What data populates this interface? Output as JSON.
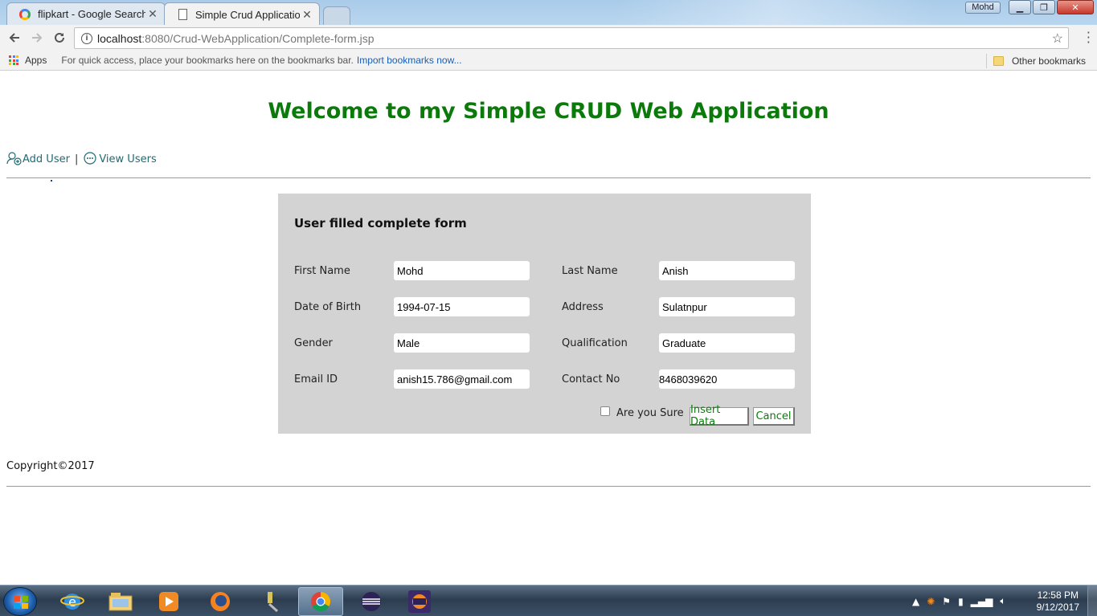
{
  "browser": {
    "tabs": [
      {
        "label": "flipkart - Google Search",
        "icon": "google-icon"
      },
      {
        "label": "Simple Crud Application",
        "icon": "document-icon"
      }
    ],
    "profile_name": "Mohd",
    "url_host": "localhost",
    "url_path": ":8080/Crud-WebApplication/Complete-form.jsp",
    "bookmarks": {
      "apps_label": "Apps",
      "hint": "For quick access, place your bookmarks here on the bookmarks bar.",
      "import_link": "Import bookmarks now...",
      "other": "Other bookmarks"
    }
  },
  "page": {
    "title": "Welcome to my Simple CRUD Web Application",
    "nav": {
      "add_user": "Add User",
      "separator": "|",
      "view_users": "View Users"
    },
    "form": {
      "title": "User filled complete form",
      "fields": {
        "first_name": {
          "label": "First Name",
          "value": "Mohd"
        },
        "last_name": {
          "label": "Last Name",
          "value": "Anish"
        },
        "dob": {
          "label": "Date of Birth",
          "value": "1994-07-15"
        },
        "address": {
          "label": "Address",
          "value": "Sulatnpur"
        },
        "gender": {
          "label": "Gender",
          "value": "Male"
        },
        "qualification": {
          "label": "Qualification",
          "value": "Graduate"
        },
        "email": {
          "label": "Email ID",
          "value": "anish15.786@gmail.com"
        },
        "contact": {
          "label": "Contact No",
          "value": "8468039620"
        }
      },
      "confirm_label": "Are you Sure",
      "insert_button": "Insert Data",
      "cancel_button": "Cancel"
    },
    "copyright": "Copyright©2017",
    "colors": {
      "heading": "#0b7a0b",
      "link": "#1f6b73",
      "form_bg": "#d3d3d3"
    }
  },
  "taskbar": {
    "time": "12:58 PM",
    "date": "9/12/2017",
    "apps": [
      "internet-explorer-icon",
      "file-explorer-icon",
      "media-player-icon",
      "firefox-icon",
      "tools-icon",
      "chrome-icon",
      "eclipse-icon",
      "java-ee-ide-icon"
    ]
  }
}
